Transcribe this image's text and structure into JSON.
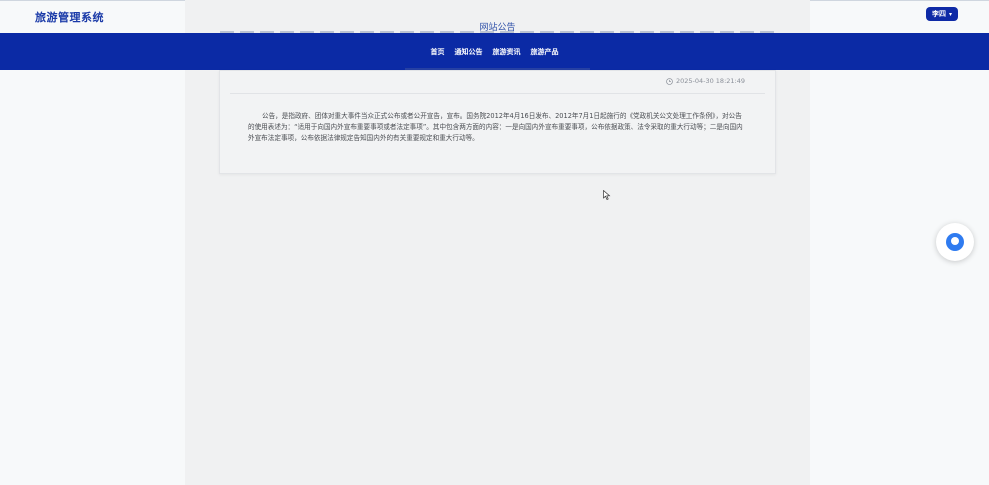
{
  "header": {
    "brand": "旅游管理系统",
    "user_name": "李四"
  },
  "page": {
    "heading": "网站公告"
  },
  "nav": {
    "items": [
      "首页",
      "通知公告",
      "旅游资讯",
      "旅游产品"
    ]
  },
  "notice": {
    "timestamp": "2025-04-30 18:21:49",
    "body": "公告，是指政府、团体对重大事件当众正式公布或者公开宣告，宣布。国务院2012年4月16日发布、2012年7月1日起施行的《党政机关公文处理工作条例》，对公告的使用表述为：“适用于向国内外宣布重要事项或者法定事项”。其中包含两方面的内容：一是向国内外宣布重要事项，公布依据政策、法令采取的重大行动等；二是向国内外宣布法定事项，公布依据法律规定告知国内外的有关重要规定和重大行动等。"
  },
  "icons": {
    "clock": "clock-icon",
    "cursor": "cursor-icon",
    "float": "chat-float-icon",
    "caret": "chevron-down-icon"
  }
}
